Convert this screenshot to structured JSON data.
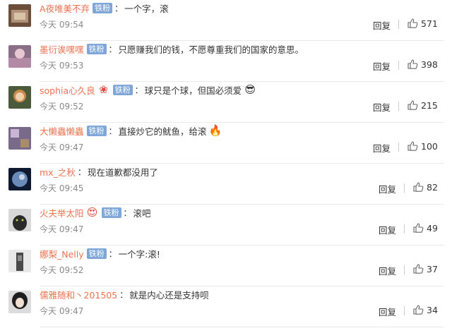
{
  "comments": [
    {
      "name": "A夜唯美不弃",
      "badge": "铁粉",
      "text": "一个字，滚",
      "emoji": "",
      "emoji_name": "",
      "time": "今天 09:54",
      "reply": "回复",
      "likes": "571",
      "avatar_color": "#6b4f3a"
    },
    {
      "name": "墨衍诶嘿嘿",
      "badge": "铁粉",
      "text": "只愿赚我们的钱，不愿尊重我们的国家的意思。",
      "emoji": "",
      "emoji_name": "",
      "time": "今天 09:53",
      "reply": "回复",
      "likes": "398",
      "avatar_color": "#8a6f86"
    },
    {
      "name": "sophia心久良",
      "badge": "铁粉",
      "text": "球只是个球，但国必须爱",
      "emoji": "😎",
      "emoji_name": "sunglasses-emoji",
      "time": "今天 09:52",
      "reply": "回复",
      "likes": "215",
      "avatar_color": "#9a6a3a"
    },
    {
      "name": "大懒蟲懒蟲",
      "badge": "铁粉",
      "text": "直接炒它的鱿鱼，给滚",
      "emoji": "🔥",
      "emoji_name": "fire-emoji",
      "time": "今天 09:47",
      "reply": "回复",
      "likes": "100",
      "avatar_color": "#7a6a8a"
    },
    {
      "name": "mx_之秋",
      "badge": "",
      "text": "现在道歉都没用了",
      "emoji": "",
      "emoji_name": "",
      "time": "今天 09:45",
      "reply": "回复",
      "likes": "82",
      "avatar_color": "#1c2a4a"
    },
    {
      "name": "火夫举太阳",
      "badge": "铁粉",
      "text": "滚吧",
      "emoji": "",
      "emoji_name": "",
      "time": "今天 09:47",
      "reply": "回复",
      "likes": "49",
      "avatar_color": "#3a3a3a"
    },
    {
      "name": "娜梨_Nelly",
      "badge": "铁粉",
      "text": "一个字:滚!",
      "emoji": "",
      "emoji_name": "",
      "time": "今天 09:52",
      "reply": "回复",
      "likes": "37",
      "avatar_color": "#5a5a5a"
    },
    {
      "name": "儒雅随和丶201505",
      "badge": "",
      "text": "就是内心还是支持呗",
      "emoji": "",
      "emoji_name": "",
      "time": "今天 09:47",
      "reply": "回复",
      "likes": "34",
      "avatar_color": "#2a2a2a"
    }
  ],
  "colors": {
    "name": "#eb7350",
    "badge_bg": "#7fa6d6",
    "time": "#8a8a8a"
  }
}
